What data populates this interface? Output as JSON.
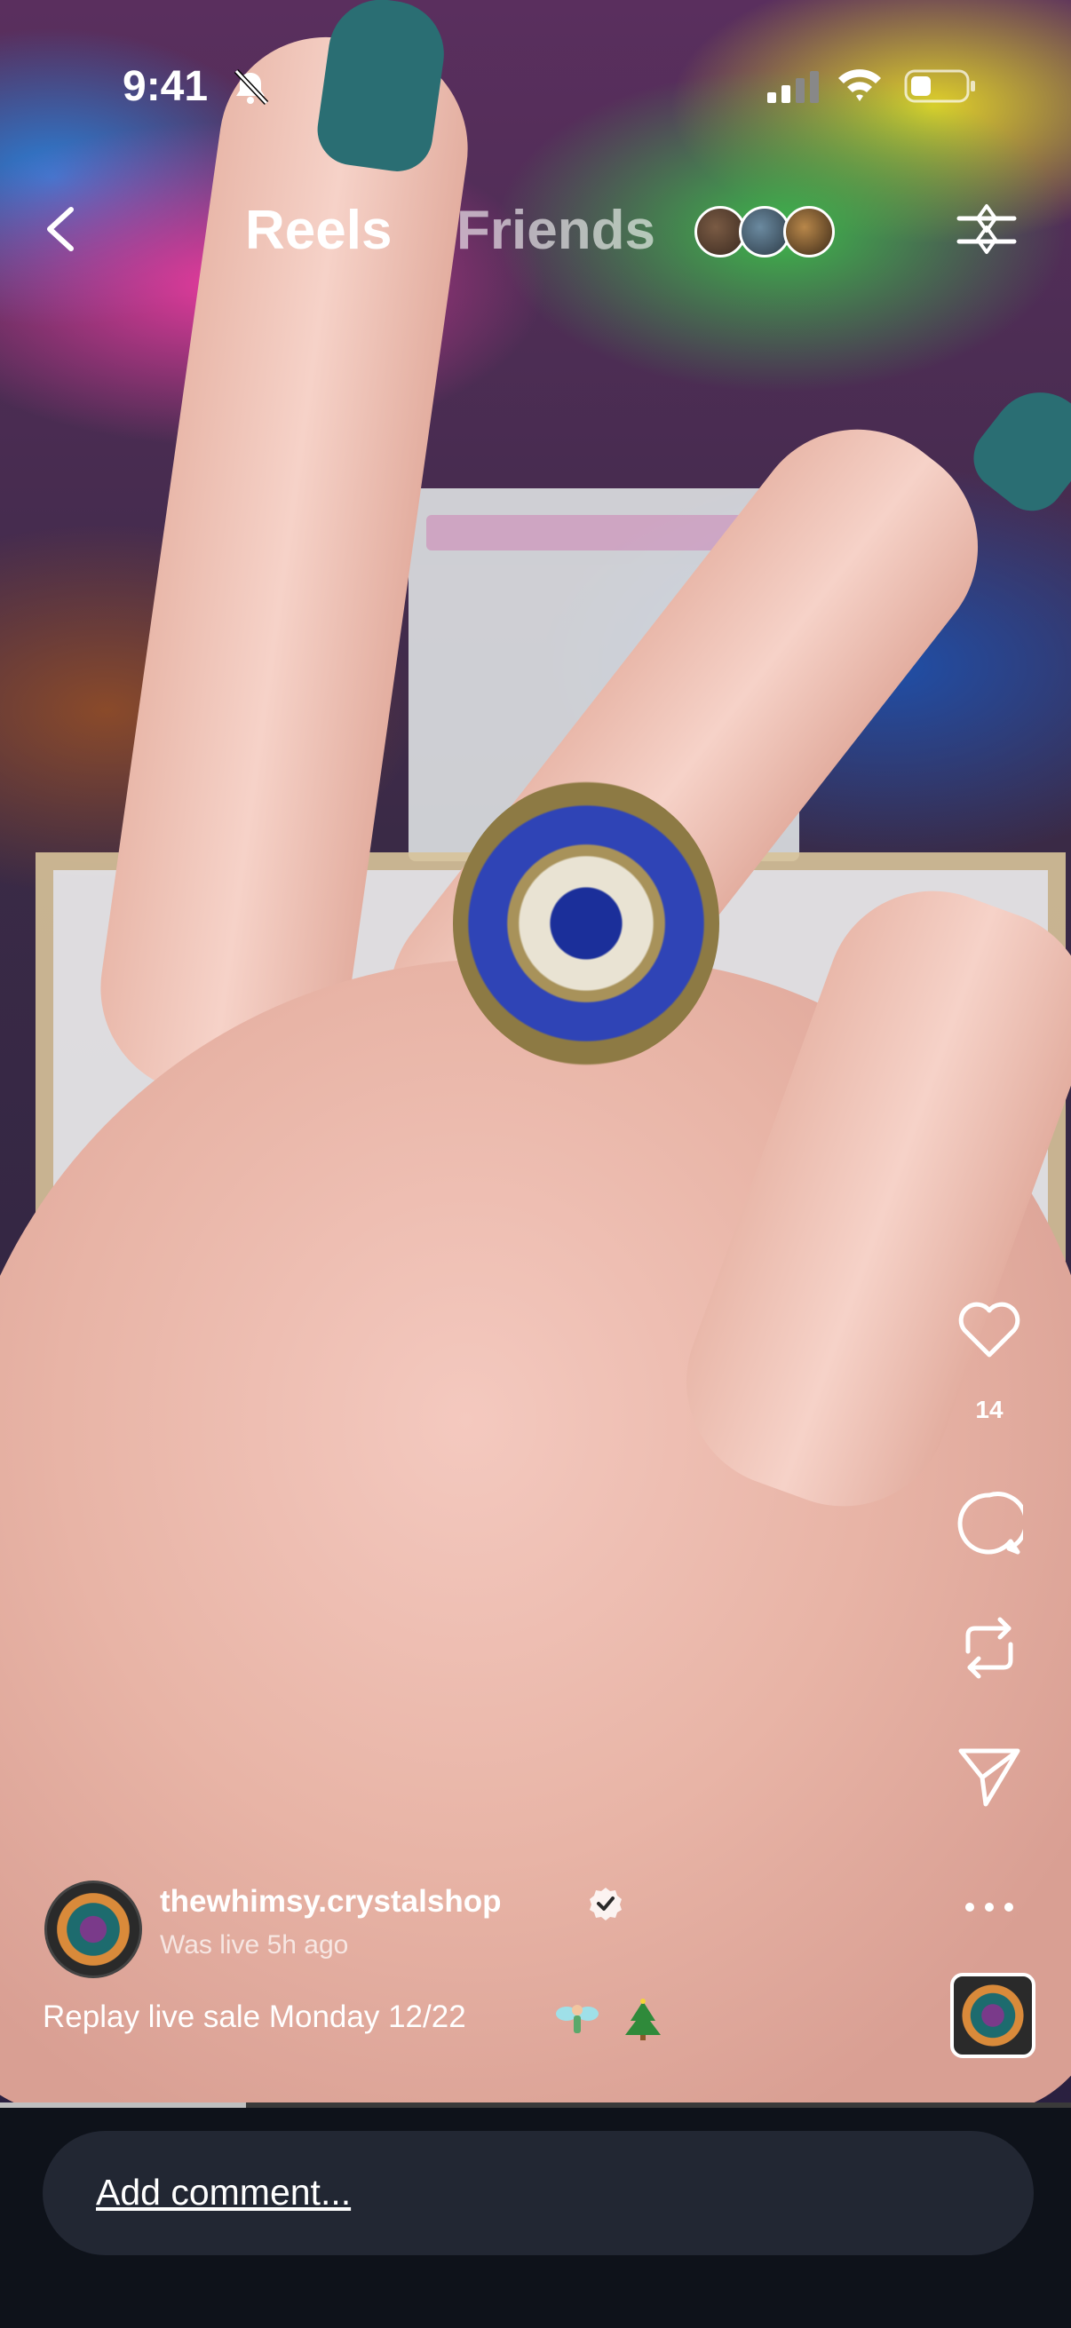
{
  "status_bar": {
    "time": "9:41"
  },
  "nav": {
    "tab_reels": "Reels",
    "tab_friends": "Friends"
  },
  "reel": {
    "like_count": "14",
    "username": "thewhimsy.crystalshop",
    "live_status": "Was live 5h ago",
    "caption": "Replay live sale Monday 12/22",
    "progress_fraction": 0.23
  },
  "comment": {
    "placeholder": "Add comment..."
  },
  "icons": {
    "back": "chevron-left-icon",
    "filter": "filter-icon",
    "like": "heart-icon",
    "comment": "comment-icon",
    "repost": "repost-icon",
    "share": "send-icon",
    "more": "more-icon"
  }
}
